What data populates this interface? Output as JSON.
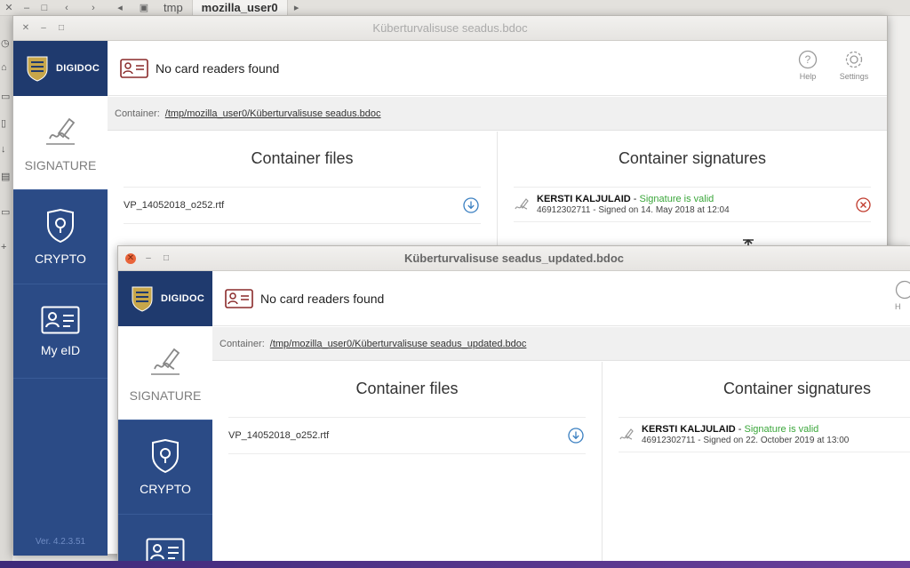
{
  "file_manager": {
    "crumbs": [
      "tmp",
      "mozilla_user0"
    ]
  },
  "window1": {
    "title": "Küberturvalisuse seadus.bdoc",
    "logo": "DIGIDOC",
    "nav": [
      {
        "label": "SIGNATURE",
        "icon": "signature-icon"
      },
      {
        "label": "CRYPTO",
        "icon": "shield-lock-icon"
      },
      {
        "label": "My eID",
        "icon": "id-card-icon"
      }
    ],
    "version": "Ver. 4.2.3.51",
    "card_message": "No card readers found",
    "help_label": "Help",
    "settings_label": "Settings",
    "container_label": "Container:",
    "container_path": "/tmp/mozilla_user0/Küberturvalisuse seadus.bdoc",
    "files_title": "Container files",
    "file_name": "VP_14052018_o252.rtf",
    "signatures_title": "Container signatures",
    "signer_name": "KERSTI KALJULAID",
    "signature_sep": " - ",
    "signature_status": "Signature is valid",
    "signature_details": "46912302711 - Signed on 14. May 2018 at 12:04"
  },
  "window2": {
    "title": "Küberturvalisuse seadus_updated.bdoc",
    "logo": "DIGIDOC",
    "nav": [
      {
        "label": "SIGNATURE",
        "icon": "signature-icon"
      },
      {
        "label": "CRYPTO",
        "icon": "shield-lock-icon"
      }
    ],
    "card_message": "No card readers found",
    "help_label": "H",
    "container_label": "Container:",
    "container_path": "/tmp/mozilla_user0/Küberturvalisuse seadus_updated.bdoc",
    "files_title": "Container files",
    "file_name": "VP_14052018_o252.rtf",
    "signatures_title": "Container signatures",
    "signer_name": "KERSTI KALJULAID",
    "signature_sep": " - ",
    "signature_status": "Signature is valid",
    "signature_details": "46912302711 - Signed on 22. October 2019 at 13:00"
  },
  "colors": {
    "sidebar": "#2b4b86",
    "valid": "#3aa63a",
    "remove": "#c0392b",
    "download": "#3a7fc1"
  }
}
